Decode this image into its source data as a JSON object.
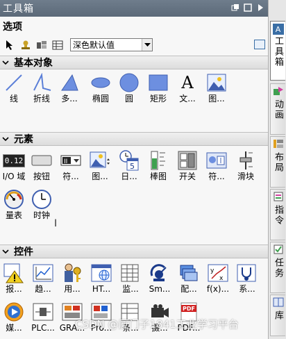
{
  "title": "工具箱",
  "options_label": "选项",
  "style_combo": {
    "value": "深色默认值"
  },
  "groups": {
    "basic": {
      "label": "基本对象",
      "items": [
        {
          "label": "线",
          "icon": "line-icon"
        },
        {
          "label": "折线",
          "icon": "polyline-icon"
        },
        {
          "label": "多...",
          "icon": "polygon-icon"
        },
        {
          "label": "椭圆",
          "icon": "ellipse-icon"
        },
        {
          "label": "圆",
          "icon": "circle-icon"
        },
        {
          "label": "矩形",
          "icon": "rectangle-icon"
        },
        {
          "label": "文...",
          "icon": "text-icon",
          "glyph": "A"
        },
        {
          "label": "图...",
          "icon": "image-icon"
        }
      ]
    },
    "elements": {
      "label": "元素",
      "items": [
        {
          "label": "I/O 域",
          "icon": "io-field-icon",
          "glyph": "0.12"
        },
        {
          "label": "按钮",
          "icon": "button-icon"
        },
        {
          "label": "符...",
          "icon": "symbolic-io-icon",
          "glyph": "II"
        },
        {
          "label": "图...",
          "icon": "graphic-view-icon"
        },
        {
          "label": "日...",
          "icon": "date-time-icon",
          "glyph": "5"
        },
        {
          "label": "棒图",
          "icon": "bar-graph-icon"
        },
        {
          "label": "开关",
          "icon": "switch-icon"
        },
        {
          "label": "符...",
          "icon": "symbol-library-icon"
        },
        {
          "label": "滑块",
          "icon": "slider-icon"
        },
        {
          "label": "量表",
          "icon": "gauge-icon"
        },
        {
          "label": "时钟",
          "icon": "clock-icon"
        }
      ]
    },
    "controls": {
      "label": "控件",
      "items": [
        {
          "label": "报...",
          "icon": "alarm-view-icon"
        },
        {
          "label": "趋...",
          "icon": "trend-view-icon"
        },
        {
          "label": "用...",
          "icon": "user-view-icon"
        },
        {
          "label": "HT...",
          "icon": "html-browser-icon"
        },
        {
          "label": "监...",
          "icon": "monitor-table-icon"
        },
        {
          "label": "Sm...",
          "icon": "sm-icon"
        },
        {
          "label": "配...",
          "icon": "recipe-view-icon"
        },
        {
          "label": "f(x)...",
          "icon": "fx-trend-icon",
          "glyph": "f(x)"
        },
        {
          "label": "系...",
          "icon": "system-diagnostics-icon"
        },
        {
          "label": "媒...",
          "icon": "media-player-icon"
        },
        {
          "label": "PLC...",
          "icon": "plc-code-viewer-icon"
        },
        {
          "label": "GRA...",
          "icon": "graph-overview-icon"
        },
        {
          "label": "Pro...",
          "icon": "prodiag-icon"
        },
        {
          "label": "条...",
          "icon": "criteria-analysis-icon"
        },
        {
          "label": "摄...",
          "icon": "camera-view-icon"
        },
        {
          "label": "PDF...",
          "icon": "pdf-view-icon",
          "glyph": "PDF"
        }
      ]
    }
  },
  "side_tabs": [
    {
      "label": "工具箱",
      "icon": "toolbox-tab-icon",
      "glyph": "A",
      "active": true
    },
    {
      "label": "动画",
      "icon": "animation-tab-icon"
    },
    {
      "label": "布局",
      "icon": "layout-tab-icon"
    },
    {
      "label": "指令",
      "icon": "instructions-tab-icon"
    },
    {
      "label": "任务",
      "icon": "tasks-tab-icon"
    },
    {
      "label": "库",
      "icon": "libraries-tab-icon"
    }
  ],
  "watermark": "CSDN @厦门子1841工业学习平台",
  "colors": {
    "titlebar": "#5f6d7c",
    "icon_blue": "#5b7fd8",
    "accent": "#3a6ea5"
  }
}
